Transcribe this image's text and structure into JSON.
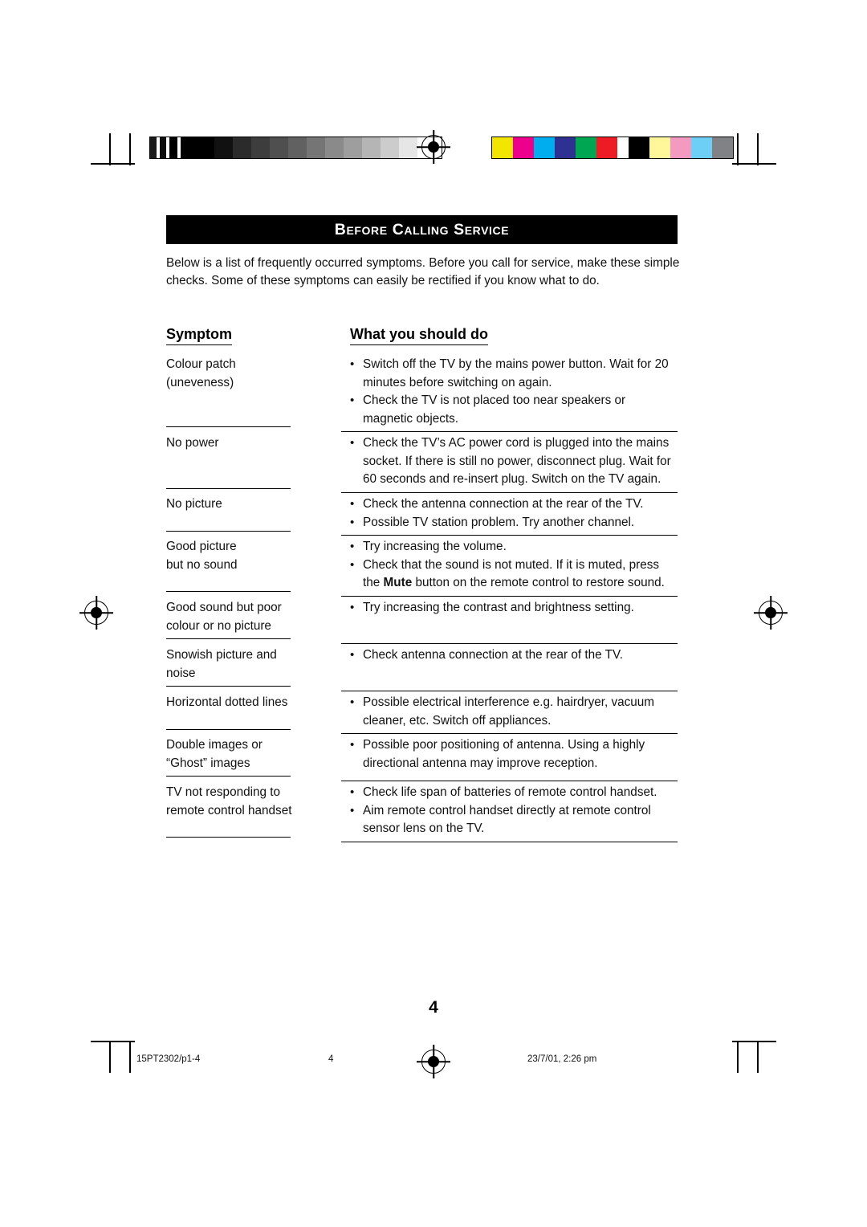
{
  "document": {
    "title": "Before Calling Service",
    "intro": "Below is a list of frequently occurred symptoms. Before you call for service, make these simple checks. Some of these symptoms can easily be rectified if you know what to do.",
    "columns": {
      "symptom": "Symptom",
      "action": "What you should do"
    },
    "rows": [
      {
        "symptom": [
          "Colour patch",
          "(uneveness)"
        ],
        "actions": [
          "Switch off the TV by the mains power button. Wait for 20 minutes before switching on again.",
          "Check the TV is not placed too near speakers or magnetic objects."
        ]
      },
      {
        "symptom": [
          "No power"
        ],
        "actions": [
          "Check the TV’s AC power cord is plugged into the mains socket. If there is still no power, disconnect plug. Wait for 60 seconds and re-insert plug. Switch on the TV again."
        ]
      },
      {
        "symptom": [
          "No picture"
        ],
        "actions": [
          "Check the antenna connection at the rear of the TV.",
          "Possible TV station problem. Try another channel."
        ]
      },
      {
        "symptom": [
          "Good picture",
          "but no sound"
        ],
        "actions": [
          "Try increasing the volume.",
          "Check that the sound is not muted. If it is muted, press the |Mute| button on the remote control to restore sound."
        ]
      },
      {
        "symptom": [
          "Good sound but poor",
          "colour or no picture"
        ],
        "actions": [
          "Try increasing the contrast and brightness setting."
        ]
      },
      {
        "symptom": [
          "Snowish picture and",
          "noise"
        ],
        "actions": [
          "Check antenna connection at the rear of the TV."
        ]
      },
      {
        "symptom": [
          "Horizontal dotted lines"
        ],
        "actions": [
          "Possible electrical interference e.g. hairdryer, vacuum cleaner, etc. Switch off appliances."
        ]
      },
      {
        "symptom": [
          "Double images or",
          "“Ghost” images"
        ],
        "actions": [
          "Possible poor positioning of antenna. Using a highly directional  antenna may improve reception."
        ]
      },
      {
        "symptom": [
          "TV not responding to",
          "remote control handset"
        ],
        "actions": [
          "Check life span of batteries of remote control handset.",
          "Aim remote control handset directly at remote control sensor lens on the TV."
        ]
      }
    ],
    "page_number": "4",
    "footer": {
      "file": "15PT2302/p1-4",
      "page": "4",
      "timestamp": "23/7/01, 2:26 pm"
    },
    "bullet_glyph": "•"
  },
  "print_marks": {
    "grayscale_swatches": [
      "#1a1a1a",
      "#ffffff",
      "#0d0d0d",
      "#ffffff",
      "#000000",
      "#000000",
      "#111111",
      "#2b2b2b",
      "#3d3d3d",
      "#4f4f4f",
      "#616161",
      "#757575",
      "#8a8a8a",
      "#9e9e9e",
      "#b5b5b5",
      "#cccccc",
      "#e6e6e6",
      "#ffffff"
    ],
    "colour_swatches": [
      "#f2e500",
      "#ec008c",
      "#00aeef",
      "#2e3192",
      "#00a651",
      "#ed1c24",
      "#000000",
      "#fff79a",
      "#f49ac1",
      "#6dcff6",
      "#808285"
    ]
  }
}
